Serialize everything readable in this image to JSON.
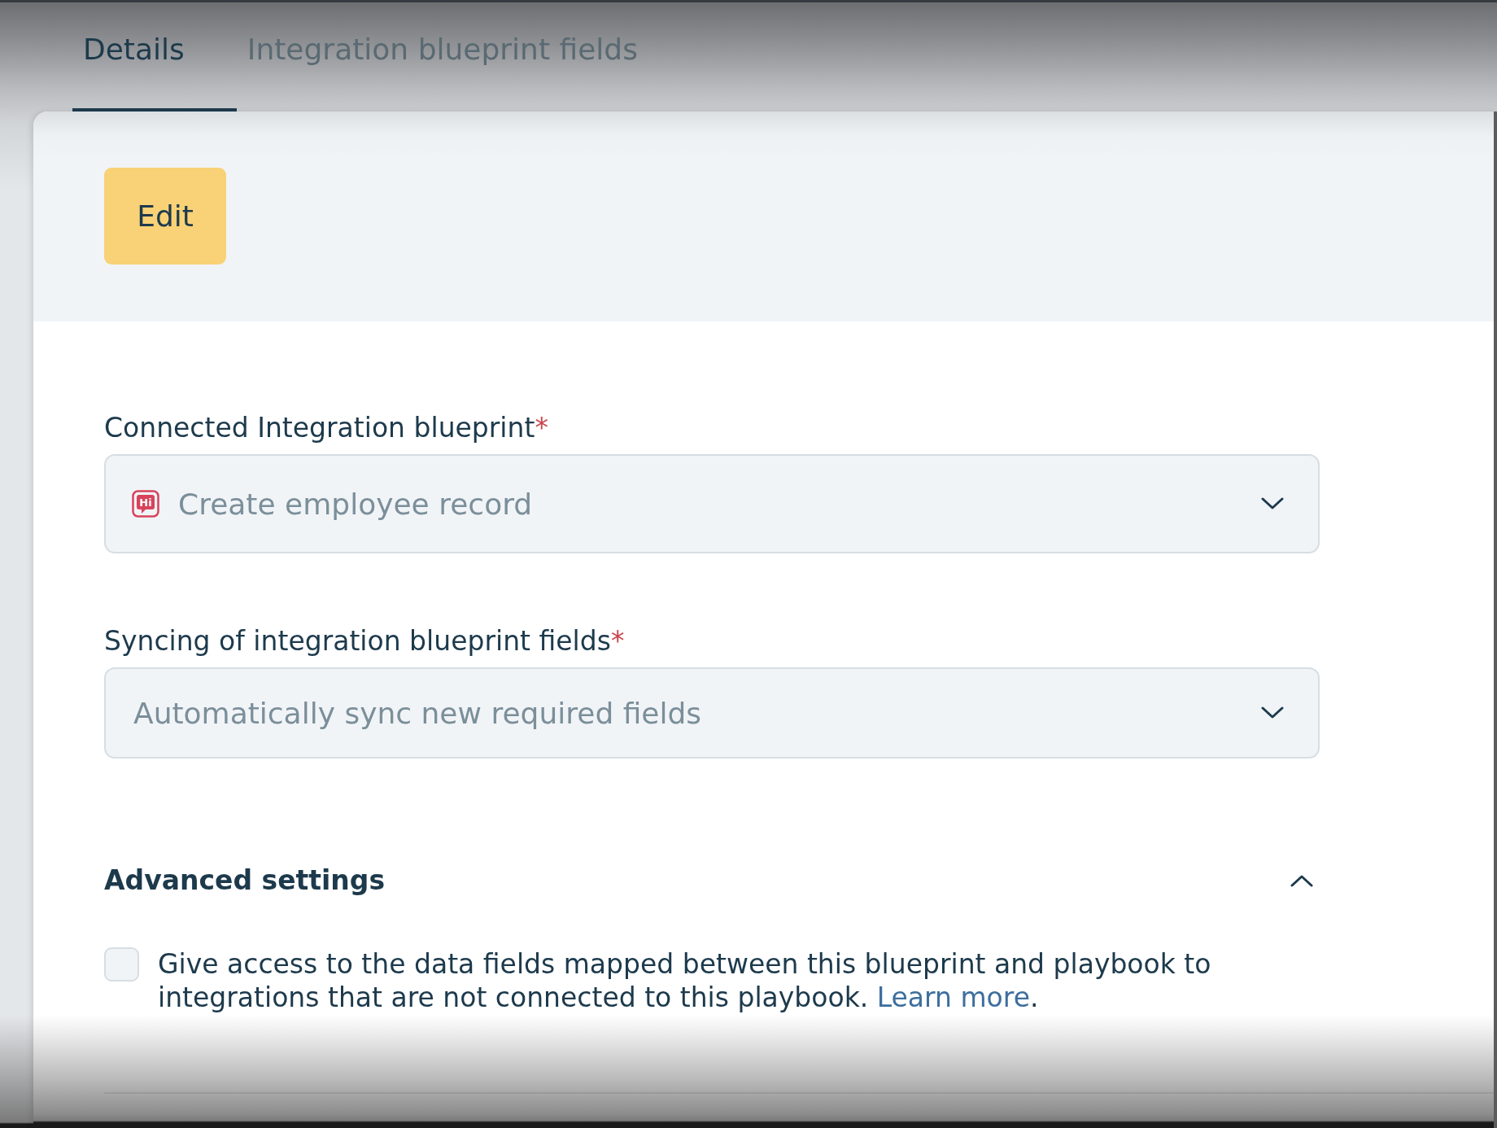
{
  "tabs": [
    {
      "label": "Details",
      "selected": true
    },
    {
      "label": "Integration blueprint fields",
      "selected": false
    }
  ],
  "toolbar": {
    "edit_button": "Edit"
  },
  "fields": [
    {
      "label": "Connected Integration blueprint",
      "required_mark": "*",
      "value": "Create employee record",
      "disabled": true,
      "kind": "app",
      "logo_text": "Hi"
    },
    {
      "label": "Syncing of integration blueprint fields",
      "required_mark": "*",
      "value": "Automatically sync new required fields",
      "disabled": true,
      "kind": "plain"
    }
  ],
  "advanced_settings": {
    "title": "Advanced settings",
    "expanded": true,
    "options": [
      {
        "checked": false,
        "text": "Give access to the data fields mapped between this blueprint and playbook to integrations that are not connected to this playbook.",
        "link": "Learn more",
        "suffix": "."
      }
    ]
  }
}
